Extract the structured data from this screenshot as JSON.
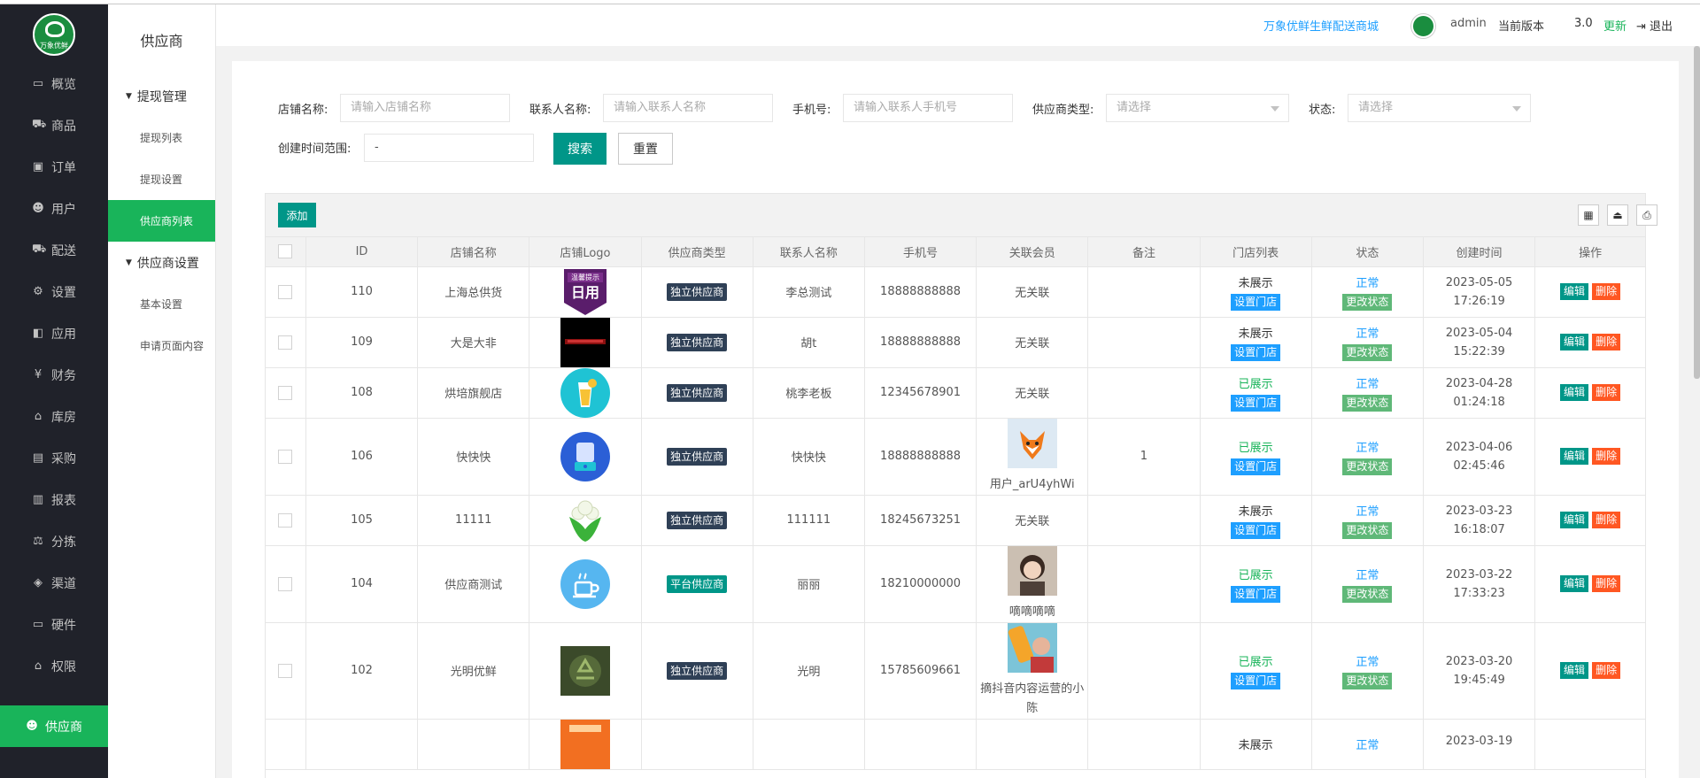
{
  "sidebar": {
    "logo_text": "万象优鲜",
    "items": [
      {
        "label": "概览",
        "icon": "monitor-icon",
        "active": false
      },
      {
        "label": "商品",
        "icon": "cart-icon",
        "active": false
      },
      {
        "label": "订单",
        "icon": "order-icon",
        "active": false
      },
      {
        "label": "用户",
        "icon": "users-icon",
        "active": false
      },
      {
        "label": "配送",
        "icon": "truck-icon",
        "active": false
      },
      {
        "label": "设置",
        "icon": "settings-icon",
        "active": false
      },
      {
        "label": "应用",
        "icon": "apps-icon",
        "active": false
      },
      {
        "label": "财务",
        "icon": "yen-icon",
        "active": false
      },
      {
        "label": "库房",
        "icon": "home-icon",
        "active": false
      },
      {
        "label": "采购",
        "icon": "purchase-icon",
        "active": false
      },
      {
        "label": "报表",
        "icon": "chart-icon",
        "active": false
      },
      {
        "label": "分拣",
        "icon": "scale-icon",
        "active": false
      },
      {
        "label": "渠道",
        "icon": "box-icon",
        "active": false
      },
      {
        "label": "硬件",
        "icon": "desktop-icon",
        "active": false
      },
      {
        "label": "权限",
        "icon": "bank-icon",
        "active": false
      },
      {
        "label": "供应商",
        "icon": "supplier-icon",
        "active": true
      }
    ]
  },
  "subsidebar": {
    "title": "供应商",
    "group1": "提现管理",
    "group1_items": [
      "提现列表",
      "提现设置"
    ],
    "active_item": "供应商列表",
    "group2": "供应商设置",
    "group2_items": [
      "基本设置",
      "申请页面内容"
    ]
  },
  "header": {
    "shop_name": "万象优鲜生鲜配送商城",
    "user": "admin",
    "version_label": "当前版本",
    "version": "3.0",
    "update": "更新",
    "logout": "退出"
  },
  "filters": {
    "shop_label": "店铺名称:",
    "shop_placeholder": "请输入店铺名称",
    "contact_label": "联系人名称:",
    "contact_placeholder": "请输入联系人名称",
    "phone_label": "手机号:",
    "phone_placeholder": "请输入联系人手机号",
    "type_label": "供应商类型:",
    "type_placeholder": "请选择",
    "status_label": "状态:",
    "status_placeholder": "请选择",
    "time_label": "创建时间范围:",
    "time_value": "-",
    "search": "搜索",
    "reset": "重置"
  },
  "toolbar": {
    "add": "添加"
  },
  "table": {
    "columns": [
      "ID",
      "店铺名称",
      "店铺Logo",
      "供应商类型",
      "联系人名称",
      "手机号",
      "关联会员",
      "备注",
      "门店列表",
      "状态",
      "创建时间",
      "操作"
    ],
    "set_store": "设置门店",
    "change_status": "更改状态",
    "edit": "编辑",
    "delete": "删除",
    "rows": [
      {
        "id": "110",
        "shop": "上海总供货",
        "logo": "notice",
        "type": "独立供应商",
        "type_color": "dark",
        "contact": "李总测试",
        "phone": "18888888888",
        "member": "无关联",
        "member_avatar": "",
        "remark": "",
        "store": "未展示",
        "store_on": false,
        "status": "正常",
        "date": "2023-05-05",
        "time": "17:26:19"
      },
      {
        "id": "109",
        "shop": "大是大非",
        "logo": "dark",
        "type": "独立供应商",
        "type_color": "dark",
        "contact": "胡t",
        "phone": "18888888888",
        "member": "无关联",
        "member_avatar": "",
        "remark": "",
        "store": "未展示",
        "store_on": false,
        "status": "正常",
        "date": "2023-05-04",
        "time": "15:22:39"
      },
      {
        "id": "108",
        "shop": "烘培旗舰店",
        "logo": "drink",
        "type": "独立供应商",
        "type_color": "dark",
        "contact": "桃李老板",
        "phone": "12345678901",
        "member": "无关联",
        "member_avatar": "",
        "remark": "",
        "store": "已展示",
        "store_on": true,
        "status": "正常",
        "date": "2023-04-28",
        "time": "01:24:18"
      },
      {
        "id": "106",
        "shop": "快快快",
        "logo": "blender",
        "type": "独立供应商",
        "type_color": "dark",
        "contact": "快快快",
        "phone": "18888888888",
        "member": "用户_arU4yhWi",
        "member_avatar": "fox",
        "remark": "1",
        "store": "已展示",
        "store_on": true,
        "status": "正常",
        "date": "2023-04-06",
        "time": "02:45:46"
      },
      {
        "id": "105",
        "shop": "11111",
        "logo": "cauliflower",
        "type": "独立供应商",
        "type_color": "dark",
        "contact": "111111",
        "phone": "18245673251",
        "member": "无关联",
        "member_avatar": "",
        "remark": "",
        "store": "未展示",
        "store_on": false,
        "status": "正常",
        "date": "2023-03-23",
        "time": "16:18:07"
      },
      {
        "id": "104",
        "shop": "供应商测试",
        "logo": "cup",
        "type": "平台供应商",
        "type_color": "green",
        "contact": "丽丽",
        "phone": "18210000000",
        "member": "嘀嘀嘀嘀",
        "member_avatar": "girl",
        "remark": "",
        "store": "已展示",
        "store_on": true,
        "status": "正常",
        "date": "2023-03-22",
        "time": "17:33:23"
      },
      {
        "id": "102",
        "shop": "光明优鲜",
        "logo": "recycle",
        "type": "独立供应商",
        "type_color": "dark",
        "contact": "光明",
        "phone": "15785609661",
        "member": "摘抖音内容运营的小陈",
        "member_avatar": "drink",
        "remark": "",
        "store": "已展示",
        "store_on": true,
        "status": "正常",
        "date": "2023-03-20",
        "time": "19:45:49"
      },
      {
        "id": "",
        "shop": "",
        "logo": "orange",
        "type": "",
        "type_color": "dark",
        "contact": "",
        "phone": "",
        "member": "",
        "member_avatar": "",
        "remark": "",
        "store": "未展示",
        "store_on": false,
        "status": "正常",
        "date": "2023-03-19",
        "time": ""
      }
    ]
  }
}
